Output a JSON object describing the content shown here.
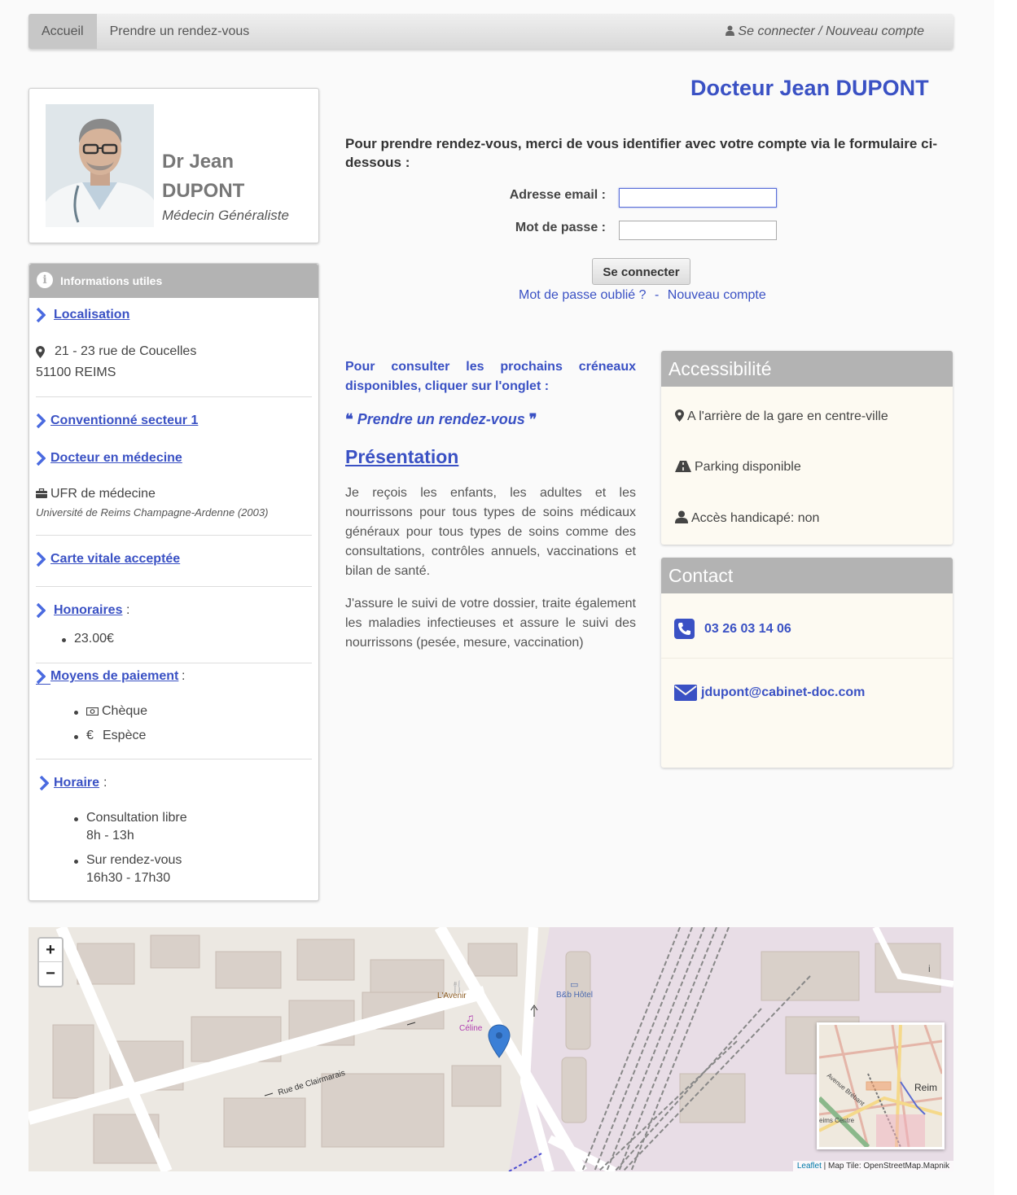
{
  "nav": {
    "home": "Accueil",
    "appointment": "Prendre un rendez-vous",
    "login": "Se connecter / Nouveau compte"
  },
  "profile": {
    "name_line1": "Dr Jean",
    "name_line2": "DUPONT",
    "specialty": "Médecin Généraliste"
  },
  "info": {
    "title": "Informations utiles",
    "location_label": "Localisation",
    "address_line1": "21 - 23 rue de Coucelles",
    "address_line2": "51100 REIMS",
    "convention_label": "Conventionné secteur 1",
    "doctor_label": "Docteur en médecine",
    "school": "UFR de médecine",
    "university": "Université de Reims Champagne-Ardenne (2003)",
    "vitale_label": "Carte vitale acceptée",
    "fees_label": "Honoraires",
    "fee_value": "23.00€",
    "payment_label": "Moyens de paiement",
    "payment_cheque": "Chèque",
    "payment_cash": "Espèce",
    "hours_label": "Horaire",
    "hours_free": "Consultation libre",
    "hours_free_time": "8h - 13h",
    "hours_rdv": "Sur rendez-vous",
    "hours_rdv_time": "16h30 - 17h30",
    "colon": ":"
  },
  "main": {
    "title": "Docteur Jean DUPONT",
    "intro": "Pour prendre rendez-vous, merci de vous identifier avec votre compte via le formulaire ci-dessous :",
    "email_label": "Adresse email :",
    "email_value": "",
    "password_label": "Mot de passe :",
    "password_value": "",
    "login_button": "Se connecter",
    "forgot_link": "Mot de passe oublié ?",
    "separator": "-",
    "new_account_link": "Nouveau compte",
    "consult_text": "Pour consulter les prochains créneaux disponibles, cliquer sur l'onglet :",
    "quote_link": "Prendre un rendez-vous",
    "presentation_title": "Présentation",
    "para1": "Je reçois les enfants, les adultes et les nourrissons pour tous types de soins médicaux généraux pour tous types de soins comme des consultations, contrôles annuels, vaccinations et bilan de santé.",
    "para2": "J'assure le suivi de votre dossier, traite également les maladies infectieuses et assure le suivi des nourrissons (pesée, mesure, vaccination)"
  },
  "accessibility": {
    "title": "Accessibilité",
    "location": "A l'arrière de la gare en centre-ville",
    "parking": "Parking disponible",
    "handicap": "Accès handicapé: non"
  },
  "contact": {
    "title": "Contact",
    "phone": "03 26 03 14 06",
    "email": "jdupont@cabinet-doc.com"
  },
  "map": {
    "zoom_in": "+",
    "zoom_out": "−",
    "street": "Rue de Clairmarais",
    "poi_restaurant": "L'Avenir",
    "poi_shop": "Céline",
    "poi_hotel": "B&b Hôtel",
    "minimap_city": "Reim",
    "minimap_street": "Avenue Brébant",
    "minimap_station": "eims Centre",
    "attribution_leaflet": "Leaflet",
    "attribution_rest": "| Map Tile: OpenStreetMap.Mapnik"
  },
  "colors": {
    "accent": "#3a51c4",
    "panel_header": "#b3b3b3",
    "panel_bg": "#fdfaf2"
  }
}
